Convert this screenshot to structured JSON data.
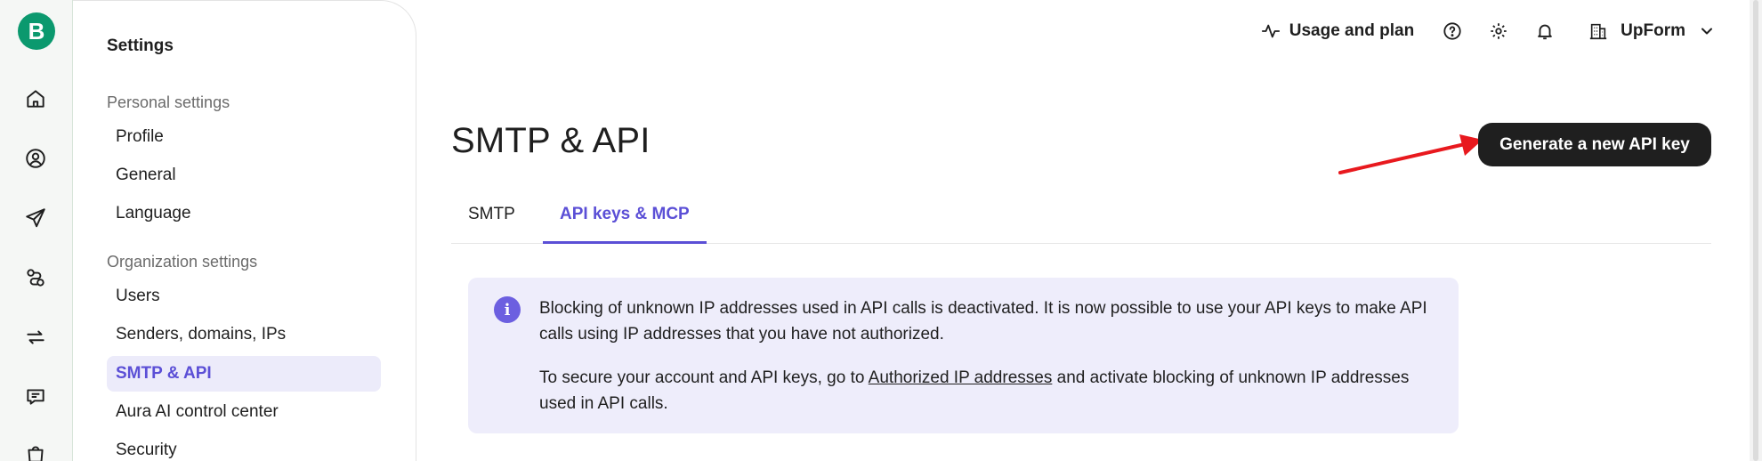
{
  "app": {
    "logo_letter": "B"
  },
  "rail": {
    "items": [
      {
        "name": "home-icon"
      },
      {
        "name": "contacts-icon"
      },
      {
        "name": "campaigns-icon"
      },
      {
        "name": "automations-icon"
      },
      {
        "name": "transactional-icon"
      },
      {
        "name": "conversations-icon"
      },
      {
        "name": "shop-icon"
      }
    ]
  },
  "topbar": {
    "usage_label": "Usage and plan",
    "org_name": "UpForm"
  },
  "settings": {
    "title": "Settings",
    "personal_label": "Personal settings",
    "personal_items": [
      "Profile",
      "General",
      "Language"
    ],
    "org_label": "Organization settings",
    "org_items": [
      "Users",
      "Senders, domains, IPs",
      "SMTP & API",
      "Aura AI control center",
      "Security"
    ],
    "active_item": "SMTP & API"
  },
  "main": {
    "title": "SMTP & API",
    "generate_button": "Generate a new API key",
    "tabs": [
      {
        "label": "SMTP",
        "active": false
      },
      {
        "label": "API keys & MCP",
        "active": true
      }
    ],
    "info": {
      "line1": "Blocking of unknown IP addresses used in API calls is deactivated. It is now possible to use your API keys to make API calls using IP addresses that you have not authorized.",
      "line2_before": "To secure your account and API keys, go to ",
      "line2_link": "Authorized IP addresses",
      "line2_after": " and activate blocking of unknown IP addresses used in API calls."
    }
  },
  "colors": {
    "brand_green": "#0b996e",
    "accent_purple": "#5b4fd6",
    "info_bg": "#eeedfb",
    "arrow_red": "#e8191e"
  }
}
